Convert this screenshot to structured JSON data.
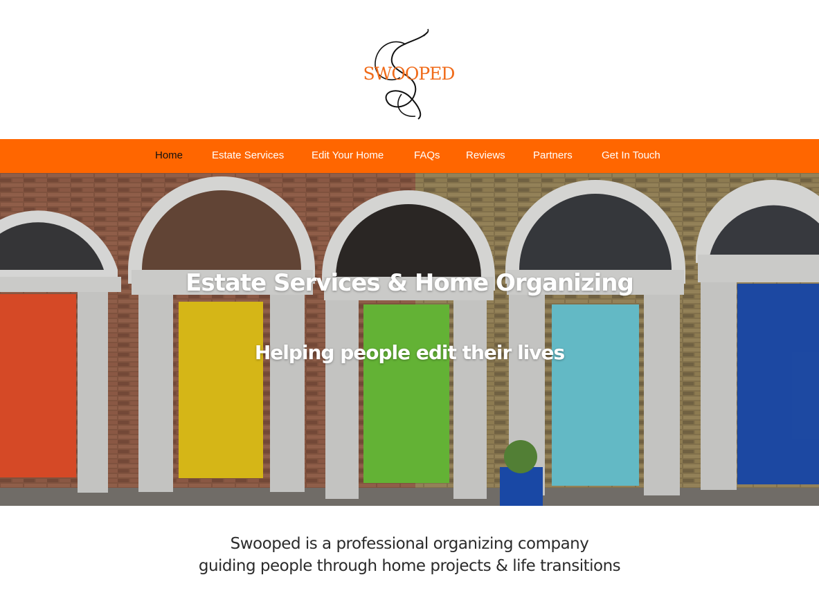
{
  "brand": {
    "logo_text": "SWOOPED",
    "accent_color": "#ff6600"
  },
  "nav": {
    "items": [
      {
        "label": "Home",
        "active": true
      },
      {
        "label": "Estate Services",
        "active": false
      },
      {
        "label": "Edit Your Home",
        "active": false
      },
      {
        "label": "FAQs",
        "active": false
      },
      {
        "label": "Reviews",
        "active": false
      },
      {
        "label": "Partners",
        "active": false
      },
      {
        "label": "Get In Touch",
        "active": false
      }
    ]
  },
  "hero": {
    "title": "Estate Services & Home Organizing",
    "subtitle": "Helping people edit their lives",
    "door_colors": [
      "#e8502a",
      "#e8c61a",
      "#6cc23a",
      "#6cc9d6",
      "#1f4fb0"
    ]
  },
  "intro": {
    "line1": "Swooped is a professional organizing company",
    "line2": "guiding people through home projects & life transitions"
  }
}
